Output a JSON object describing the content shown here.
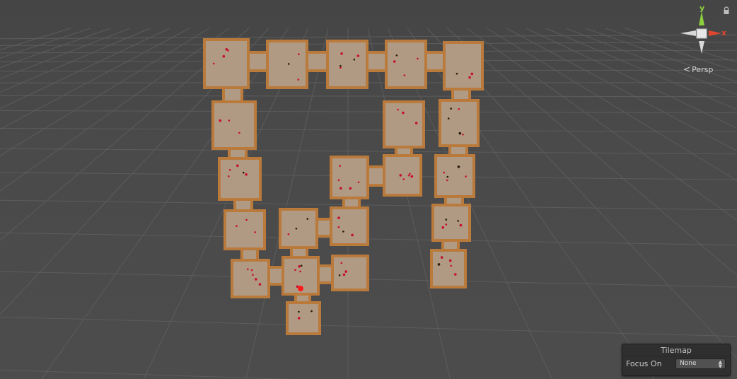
{
  "scene_view": {
    "projection_label": "Persp",
    "axes": {
      "y_label": "y",
      "x_label": "x"
    },
    "colors": {
      "background": "#474747",
      "grid_line": "#5c5c5c",
      "floor": "#b09a83",
      "wall": "#b97a3c",
      "enemy_marker": "#c8102e",
      "axis_y": "#8ccf3c",
      "axis_x": "#e0452f",
      "axis_neutral": "#d8d8d8"
    }
  },
  "overlay": {
    "tilemap": {
      "title": "Tilemap",
      "focus_label": "Focus On",
      "focus_value": "None"
    }
  },
  "icons": {
    "lock": "lock-icon",
    "gizmo": "orientation-gizmo-icon",
    "select_arrows": "up-down-arrows-icon"
  }
}
